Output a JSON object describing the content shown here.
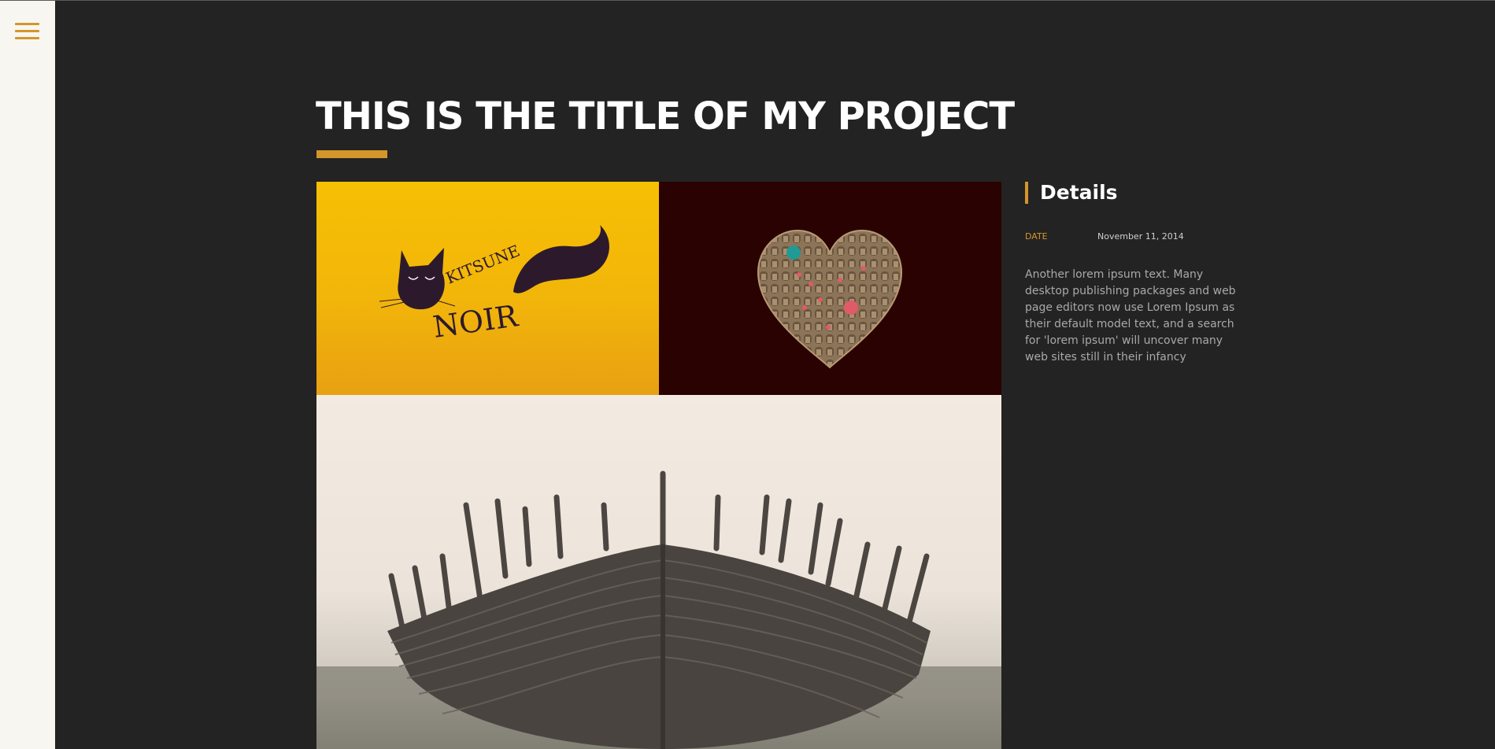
{
  "nav": {
    "menu_icon": "hamburger-menu-icon"
  },
  "project": {
    "title": "THIS IS THE TITLE OF MY PROJECT"
  },
  "gallery": {
    "images": [
      {
        "name": "kitsune-noir-artwork",
        "logo_line1": "KITSUNE",
        "logo_line2": "NOIR"
      },
      {
        "name": "heart-of-windows-artwork"
      },
      {
        "name": "old-wooden-boat-photo"
      }
    ]
  },
  "details": {
    "heading": "Details",
    "date_label": "DATE",
    "date_value": "November 11, 2014",
    "description": "Another lorem ipsum text. Many desktop publishing packages and web page editors now use Lorem Ipsum as their default model text, and a search for 'lorem ipsum' will uncover many web sites still in their infancy"
  },
  "colors": {
    "accent": "#d4952a",
    "background": "#232323",
    "side_rail": "#f7f6f1"
  }
}
